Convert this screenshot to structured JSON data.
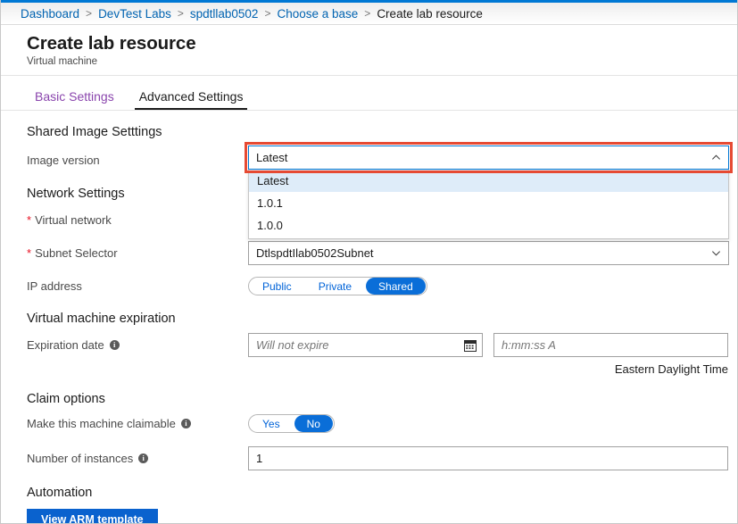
{
  "breadcrumb": {
    "items": [
      {
        "label": "Dashboard",
        "current": false
      },
      {
        "label": "DevTest Labs",
        "current": false
      },
      {
        "label": "spdtllab0502",
        "current": false
      },
      {
        "label": "Choose a base",
        "current": false
      },
      {
        "label": "Create lab resource",
        "current": true
      }
    ],
    "separator": ">"
  },
  "header": {
    "title": "Create lab resource",
    "subtitle": "Virtual machine"
  },
  "tabs": [
    {
      "label": "Basic Settings",
      "active": false
    },
    {
      "label": "Advanced Settings",
      "active": true
    }
  ],
  "sections": {
    "shared_image": {
      "heading": "Shared Image Setttings",
      "image_version": {
        "label": "Image version",
        "value": "Latest",
        "expanded": true,
        "options": [
          "Latest",
          "1.0.1",
          "1.0.0"
        ],
        "selected_option": "Latest",
        "highlight_color": "#e64a33"
      }
    },
    "network": {
      "heading": "Network Settings",
      "virtual_network": {
        "label": "Virtual network",
        "required": true,
        "required_marker": "*"
      },
      "subnet_selector": {
        "label": "Subnet Selector",
        "required": true,
        "required_marker": "*",
        "value": "DtlspdtIlab0502Subnet"
      },
      "ip_address": {
        "label": "IP address",
        "options": [
          "Public",
          "Private",
          "Shared"
        ],
        "selected": "Shared"
      }
    },
    "expiration": {
      "heading": "Virtual machine expiration",
      "expiration_date": {
        "label": "Expiration date",
        "has_info": true,
        "date_placeholder": "Will not expire",
        "time_placeholder": "h:mm:ss A",
        "calendar_icon": "calendar-icon"
      },
      "timezone_note": "Eastern Daylight Time"
    },
    "claim": {
      "heading": "Claim options",
      "claimable": {
        "label": "Make this machine claimable",
        "has_info": true,
        "options": [
          "Yes",
          "No"
        ],
        "selected": "No"
      },
      "instances": {
        "label": "Number of instances",
        "has_info": true,
        "value": "1"
      }
    },
    "automation": {
      "heading": "Automation",
      "view_arm_button": "View ARM template"
    }
  },
  "colors": {
    "accent_blue": "#0078d4",
    "toggle_blue": "#0a6ed8",
    "button_blue": "#0a62ce",
    "link_blue": "#0063b1",
    "tab_visited_purple": "#8a45ad",
    "required_red": "#e81123",
    "annotation_red": "#e64a33",
    "option_highlight": "#deecf9"
  },
  "icons": {
    "chevron_up": "chevron-up-icon",
    "chevron_down": "chevron-down-icon",
    "info": "info-icon"
  }
}
